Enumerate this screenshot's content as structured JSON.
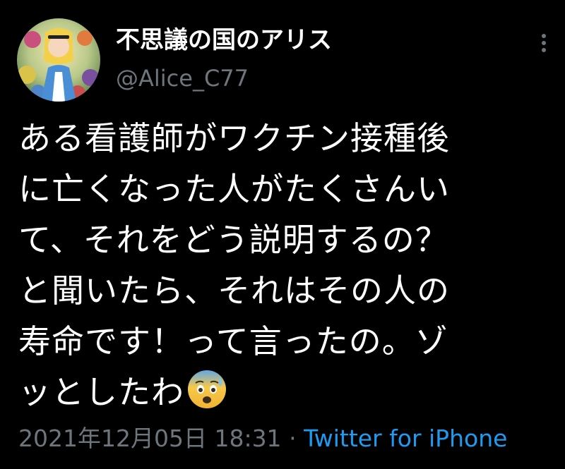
{
  "user": {
    "display_name": "不思議の国のアリス",
    "handle": "@Alice_C77",
    "avatar_icon": "alice-avatar"
  },
  "menu": {
    "icon": "more-vertical-icon"
  },
  "tweet": {
    "lines": [
      "ある看護師がワクチン接種後",
      "に亡くなった人がたくさんい",
      "て、それをどう説明するの？",
      "と聞いたら、それはその人の",
      "寿命です！って言ったの。ゾ",
      "ッとしたわ"
    ],
    "emoji": "anxious-face-with-sweat-emoji"
  },
  "meta": {
    "date": "2021年12月05日 18:31",
    "separator": "·",
    "source": "Twitter for iPhone"
  },
  "colors": {
    "background": "#000000",
    "text": "#ffffff",
    "secondary": "#6e767d",
    "link": "#1d9bf0"
  }
}
